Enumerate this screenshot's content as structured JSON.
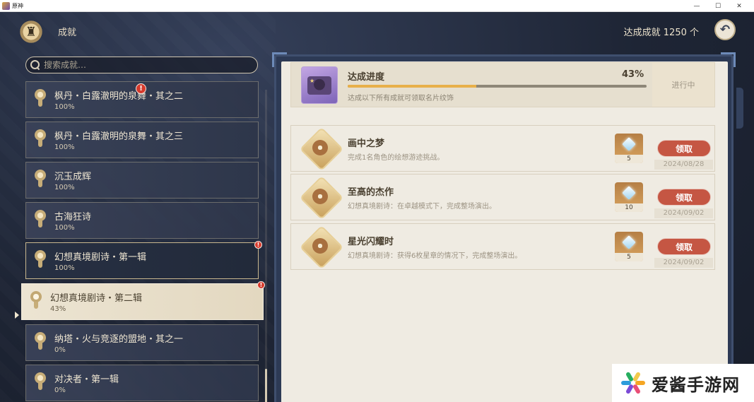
{
  "window": {
    "title": "原神",
    "minimize": "—",
    "maximize": "☐",
    "close": "✕"
  },
  "header": {
    "title": "成就",
    "total_label": "达成成就 1250 个"
  },
  "search": {
    "placeholder": "搜索成就…"
  },
  "categories": [
    {
      "name": "枫丹・白露澈明的泉舞・其之二",
      "percent": "100%",
      "alert": true
    },
    {
      "name": "枫丹・白露澈明的泉舞・其之三",
      "percent": "100%",
      "alert": false
    },
    {
      "name": "沉玉成辉",
      "percent": "100%",
      "alert": false
    },
    {
      "name": "古海狂诗",
      "percent": "100%",
      "alert": false
    },
    {
      "name": "幻想真境剧诗・第一辑",
      "percent": "100%",
      "alert": true
    },
    {
      "name": "幻想真境剧诗・第二辑",
      "percent": "43%",
      "alert": true,
      "selected": true
    },
    {
      "name": "纳塔・火与竞逐的盟地・其之一",
      "percent": "0%",
      "alert": false
    },
    {
      "name": "对决者・第一辑",
      "percent": "0%",
      "alert": false
    }
  ],
  "progress": {
    "title": "达成进度",
    "percent_label": "43%",
    "percent_value": 0.43,
    "description": "达成以下所有成就可领取名片纹饰",
    "status": "进行中"
  },
  "achievements": [
    {
      "title": "画中之梦",
      "description": "完成1名角色的绘想游迹挑战。",
      "reward_count": "5",
      "claim_label": "领取",
      "date": "2024/08/28"
    },
    {
      "title": "至高的杰作",
      "description": "幻想真境剧诗：在卓越模式下，完成整场演出。",
      "reward_count": "10",
      "claim_label": "领取",
      "date": "2024/09/02"
    },
    {
      "title": "星光闪耀时",
      "description": "幻想真境剧诗：获得6枚星章的情况下，完成整场演出。",
      "reward_count": "5",
      "claim_label": "领取",
      "date": "2024/09/02"
    }
  ],
  "watermark": {
    "text": "爱酱手游网"
  },
  "colors": {
    "accent_gold": "#e8b04a",
    "claim_red": "#c55643",
    "panel_paper": "#efebe2",
    "alert_red": "#d63a2c"
  }
}
